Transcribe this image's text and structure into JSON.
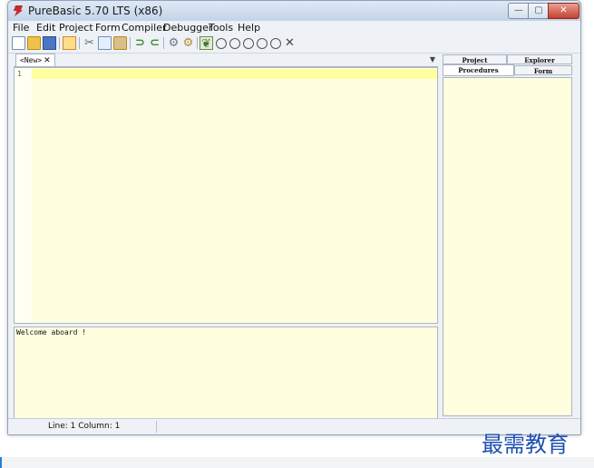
{
  "window": {
    "title": "PureBasic 5.70 LTS (x86)",
    "controls": {
      "minimize": "—",
      "maximize": "▢",
      "close": "✕"
    }
  },
  "menubar": [
    "File",
    "Edit",
    "Project",
    "Form",
    "Compiler",
    "Debugger",
    "Tools",
    "Help"
  ],
  "toolbar": {
    "icons": [
      "new-file-icon",
      "open-file-icon",
      "save-icon",
      "close-file-icon",
      "cut-icon",
      "copy-icon",
      "paste-icon",
      "undo-icon",
      "redo-icon",
      "compile-run-icon",
      "debug-settings-icon",
      "debugger-icon",
      "pause-icon",
      "continue-icon",
      "step-icon",
      "step-over-icon",
      "step-out-icon",
      "kill-program-icon"
    ],
    "kill_symbol": "✕"
  },
  "editor": {
    "tab_label": "<New>",
    "tab_close": "✕",
    "dropdown": "▼",
    "line_number": "1",
    "output_text": "Welcome aboard !"
  },
  "panel": {
    "tabs": [
      "Project",
      "Explorer",
      "Procedures",
      "Form"
    ],
    "active_tab": "Procedures"
  },
  "status": {
    "position": "Line: 1   Column: 1"
  },
  "watermark": "最需教育"
}
